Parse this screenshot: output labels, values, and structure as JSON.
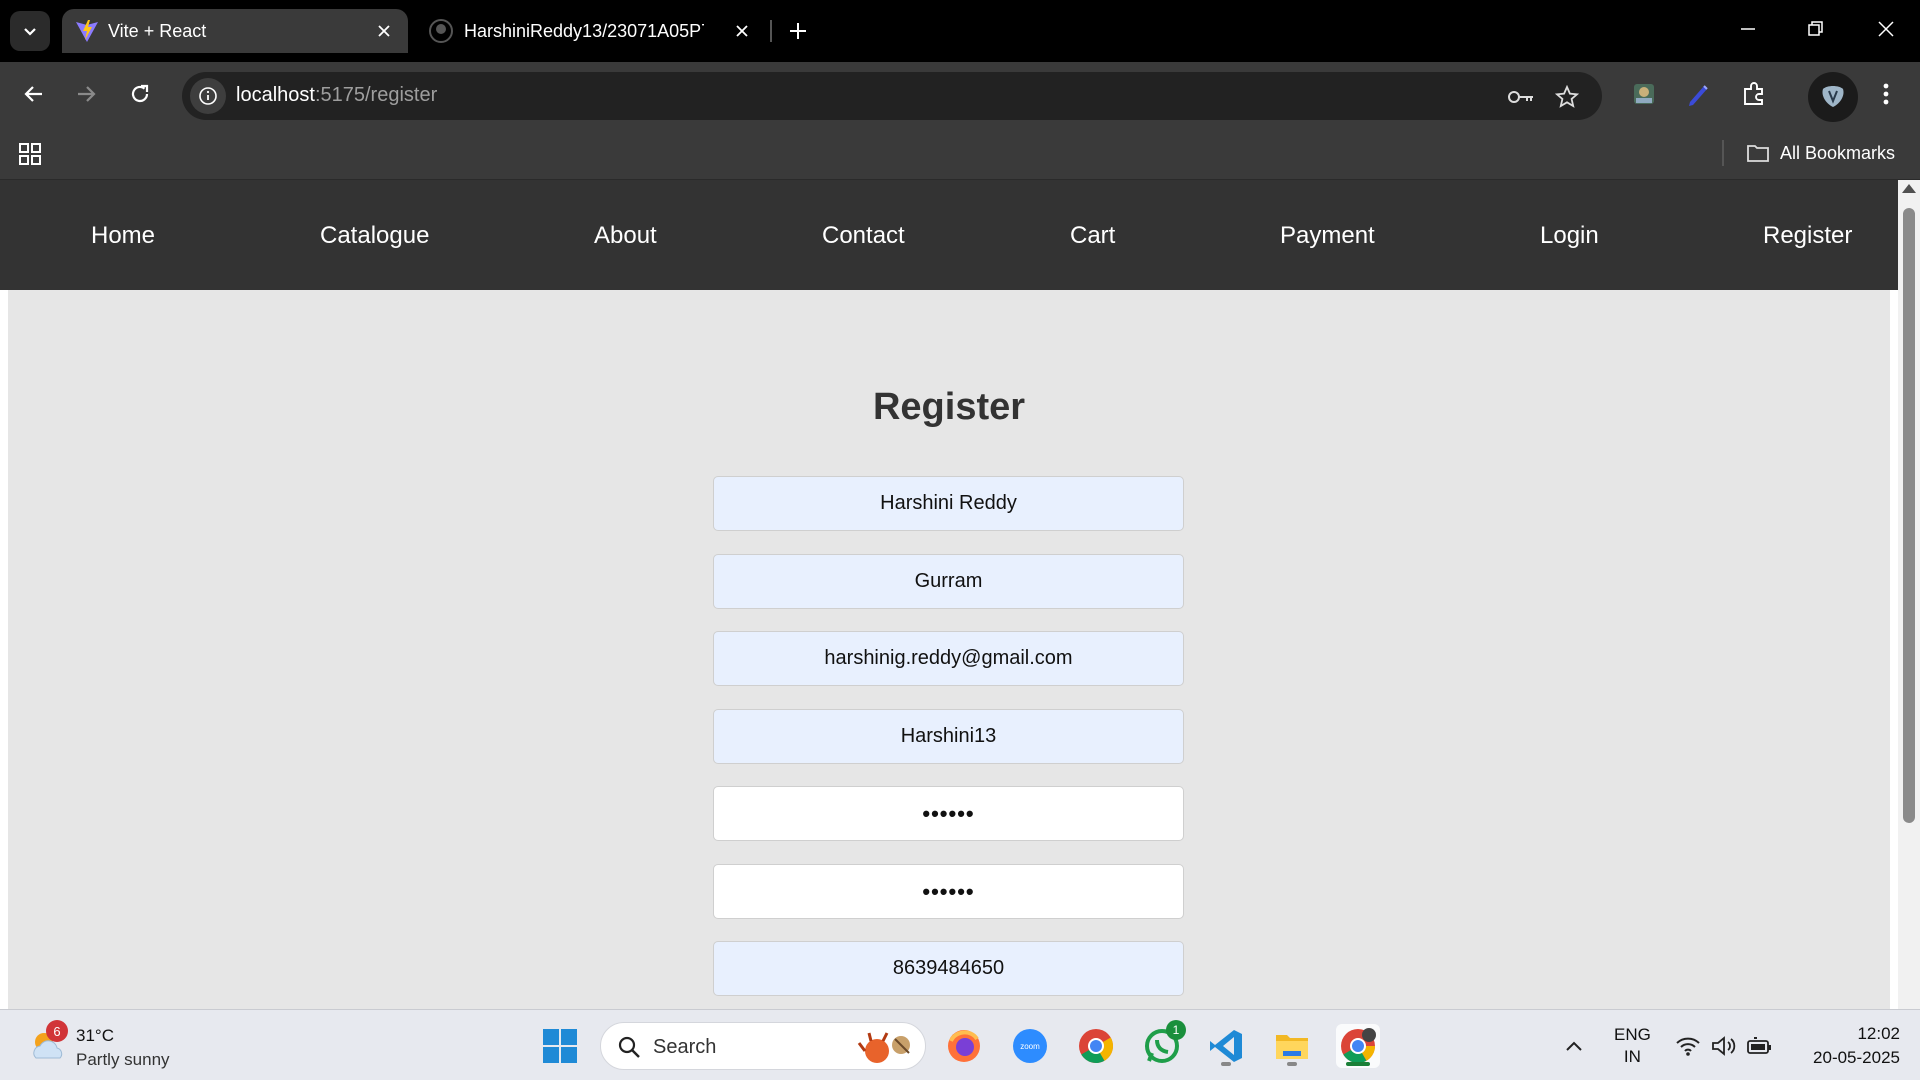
{
  "browser": {
    "tabs": [
      {
        "title": "Vite + React",
        "active": true
      },
      {
        "title": "HarshiniReddy13/23071A05P7_",
        "active": false
      }
    ],
    "url": {
      "host": "localhost",
      "rest": ":5175/register"
    },
    "bookmarks": {
      "all_label": "All Bookmarks"
    }
  },
  "site_nav": {
    "items": [
      "Home",
      "Catalogue",
      "About",
      "Contact",
      "Cart",
      "Payment",
      "Login",
      "Register"
    ]
  },
  "form": {
    "title": "Register",
    "fields": [
      {
        "value": "Harshini Reddy",
        "autofilled": true
      },
      {
        "value": "Gurram",
        "autofilled": true
      },
      {
        "value": "harshinig.reddy@gmail.com",
        "autofilled": true
      },
      {
        "value": "Harshini13",
        "autofilled": true
      },
      {
        "value": "••••••",
        "autofilled": false
      },
      {
        "value": "••••••",
        "autofilled": false
      },
      {
        "value": "8639484650",
        "autofilled": true
      }
    ]
  },
  "taskbar": {
    "weather": {
      "temp": "31°C",
      "desc": "Partly sunny",
      "badge": "6"
    },
    "search_label": "Search",
    "whatsapp_badge": "1",
    "lang": {
      "line1": "ENG",
      "line2": "IN"
    },
    "clock": {
      "time": "12:02",
      "date": "20-05-2025"
    }
  },
  "colors": {
    "nav_bg": "#333333",
    "page_bg": "#e6e6e6",
    "autofill_bg": "#e8f0fe"
  }
}
